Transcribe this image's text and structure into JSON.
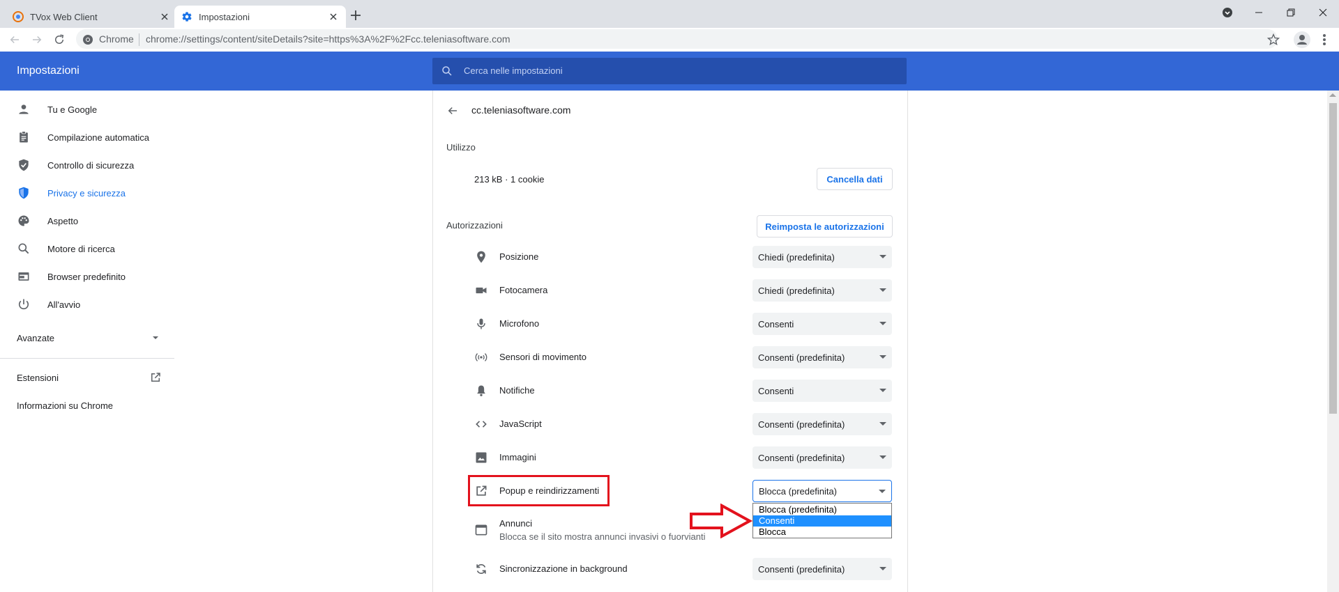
{
  "tabs": [
    {
      "title": "TVox Web Client",
      "active": false
    },
    {
      "title": "Impostazioni",
      "active": true
    }
  ],
  "toolbar": {
    "site_label": "Chrome",
    "url": "chrome://settings/content/siteDetails?site=https%3A%2F%2Fcc.teleniasoftware.com"
  },
  "header": {
    "title": "Impostazioni",
    "search_placeholder": "Cerca nelle impostazioni"
  },
  "sidebar": {
    "items": [
      {
        "label": "Tu e Google",
        "icon": "person-icon"
      },
      {
        "label": "Compilazione automatica",
        "icon": "clipboard-icon"
      },
      {
        "label": "Controllo di sicurezza",
        "icon": "shield-check-icon"
      },
      {
        "label": "Privacy e sicurezza",
        "icon": "shield-icon"
      },
      {
        "label": "Aspetto",
        "icon": "palette-icon"
      },
      {
        "label": "Motore di ricerca",
        "icon": "search-icon"
      },
      {
        "label": "Browser predefinito",
        "icon": "browser-icon"
      },
      {
        "label": "All'avvio",
        "icon": "power-icon"
      }
    ],
    "advanced": "Avanzate",
    "extensions": "Estensioni",
    "about": "Informazioni su Chrome"
  },
  "site": {
    "host": "cc.teleniasoftware.com",
    "usage_title": "Utilizzo",
    "usage_value": "213 kB · 1 cookie",
    "clear_button": "Cancella dati",
    "permissions_title": "Autorizzazioni",
    "reset_button": "Reimposta le autorizzazioni"
  },
  "permissions": [
    {
      "label": "Posizione",
      "value": "Chiedi (predefinita)",
      "icon": "location-pin-icon"
    },
    {
      "label": "Fotocamera",
      "value": "Chiedi (predefinita)",
      "icon": "camera-icon"
    },
    {
      "label": "Microfono",
      "value": "Consenti",
      "icon": "microphone-icon"
    },
    {
      "label": "Sensori di movimento",
      "value": "Consenti (predefinita)",
      "icon": "motion-sensor-icon"
    },
    {
      "label": "Notifiche",
      "value": "Consenti",
      "icon": "bell-icon"
    },
    {
      "label": "JavaScript",
      "value": "Consenti (predefinita)",
      "icon": "code-icon"
    },
    {
      "label": "Immagini",
      "value": "Consenti (predefinita)",
      "icon": "image-icon"
    },
    {
      "label": "Popup e reindirizzamenti",
      "value": "Blocca (predefinita)",
      "icon": "open-in-new-icon"
    },
    {
      "label": "Annunci",
      "sublabel": "Blocca se il sito mostra annunci invasivi o fuorvianti",
      "icon": "ads-icon"
    },
    {
      "label": "Sincronizzazione in background",
      "value": "Consenti (predefinita)",
      "icon": "sync-icon"
    }
  ],
  "dropdown_options": [
    "Blocca (predefinita)",
    "Consenti",
    "Blocca"
  ],
  "dropdown_selected": "Consenti",
  "colors": {
    "accent": "#1a73e8",
    "header": "#3367d6",
    "annotation": "#e3121d"
  }
}
